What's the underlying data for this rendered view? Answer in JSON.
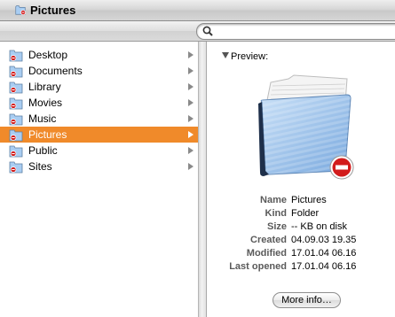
{
  "window": {
    "title": "Pictures"
  },
  "search": {
    "placeholder": ""
  },
  "sidebar": {
    "items": [
      {
        "label": "Desktop",
        "selected": false
      },
      {
        "label": "Documents",
        "selected": false
      },
      {
        "label": "Library",
        "selected": false
      },
      {
        "label": "Movies",
        "selected": false
      },
      {
        "label": "Music",
        "selected": false
      },
      {
        "label": "Pictures",
        "selected": true
      },
      {
        "label": "Public",
        "selected": false
      },
      {
        "label": "Sites",
        "selected": false
      }
    ]
  },
  "preview": {
    "header": "Preview:",
    "info": [
      {
        "key": "Name",
        "value": "Pictures"
      },
      {
        "key": "Kind",
        "value": "Folder"
      },
      {
        "key": "Size",
        "value": "-- KB on disk"
      },
      {
        "key": "Created",
        "value": "04.09.03 19.35"
      },
      {
        "key": "Modified",
        "value": "17.01.04 06.16"
      },
      {
        "key": "Last opened",
        "value": "17.01.04 06.16"
      }
    ],
    "more_button": "More info…"
  },
  "colors": {
    "selection": "#f08a2a",
    "no_entry_badge": "#d21c1c",
    "folder_blue": "#9fc7ef"
  },
  "icons": {
    "folder": "folder-icon",
    "no_access_badge": "no-entry-badge-icon",
    "search": "search-icon"
  }
}
